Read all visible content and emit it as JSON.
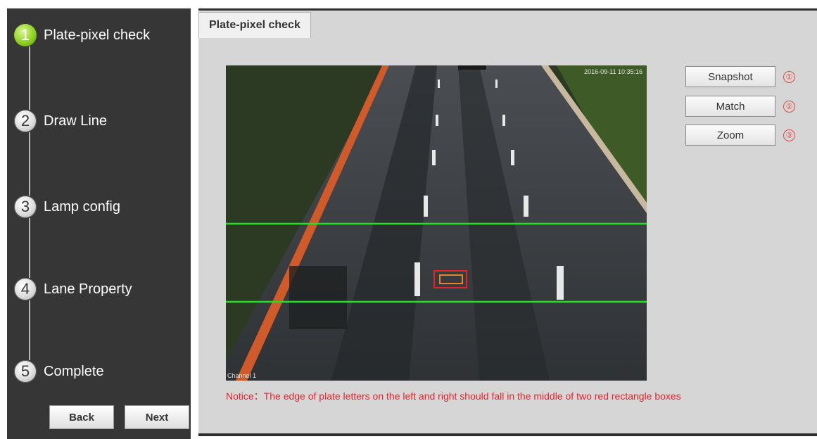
{
  "wizard": {
    "steps": [
      {
        "number": "1",
        "label": "Plate-pixel check",
        "active": true
      },
      {
        "number": "2",
        "label": "Draw Line",
        "active": false
      },
      {
        "number": "3",
        "label": "Lamp config",
        "active": false
      },
      {
        "number": "4",
        "label": "Lane Property",
        "active": false
      },
      {
        "number": "5",
        "label": "Complete",
        "active": false
      }
    ],
    "back_label": "Back",
    "next_label": "Next"
  },
  "tab": {
    "label": "Plate-pixel check"
  },
  "video": {
    "timestamp": "2016-09-11 10:35:16",
    "channel": "Channel 1"
  },
  "actions": [
    {
      "label": "Snapshot",
      "badge": "①"
    },
    {
      "label": "Match",
      "badge": "②"
    },
    {
      "label": "Zoom",
      "badge": "③"
    }
  ],
  "notice": "Notice：The edge of plate letters on the left and right should fall in the middle of two red rectangle boxes",
  "colors": {
    "active_step": "#8ed21f",
    "guide_line": "#22e022",
    "plate_box": "#e8222c",
    "notice_text": "#e8222c"
  }
}
